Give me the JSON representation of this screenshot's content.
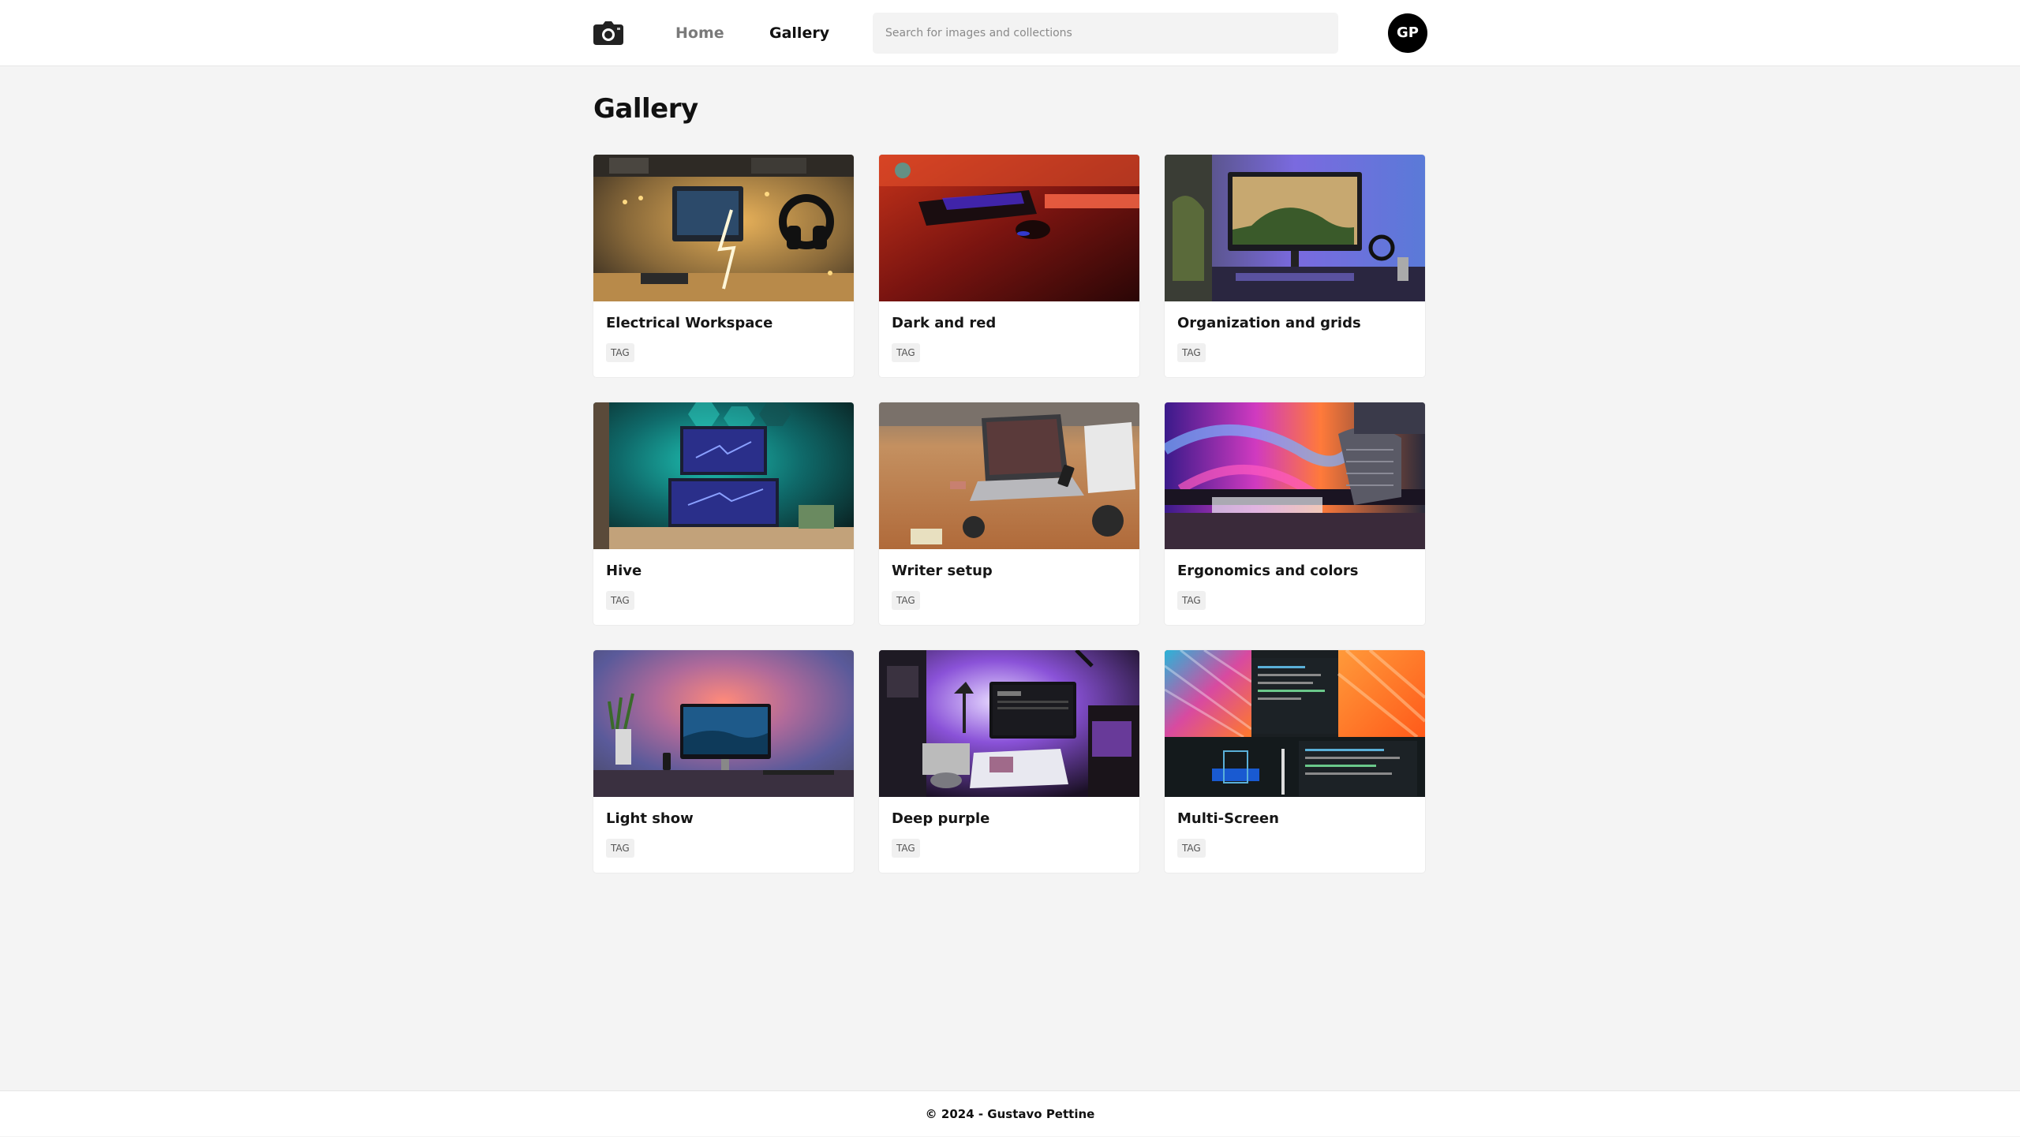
{
  "header": {
    "nav": {
      "home": "Home",
      "gallery": "Gallery"
    },
    "search": {
      "placeholder": "Search for images and collections",
      "value": ""
    },
    "avatar": "GP"
  },
  "page": {
    "title": "Gallery"
  },
  "cards": [
    {
      "title": "Electrical Workspace",
      "tag": "TAG",
      "theme": "electrical"
    },
    {
      "title": "Dark and red",
      "tag": "TAG",
      "theme": "darkred"
    },
    {
      "title": "Organization and grids",
      "tag": "TAG",
      "theme": "organization"
    },
    {
      "title": "Hive",
      "tag": "TAG",
      "theme": "hive"
    },
    {
      "title": "Writer setup",
      "tag": "TAG",
      "theme": "writer"
    },
    {
      "title": "Ergonomics and colors",
      "tag": "TAG",
      "theme": "ergonomics"
    },
    {
      "title": "Light show",
      "tag": "TAG",
      "theme": "lightshow"
    },
    {
      "title": "Deep purple",
      "tag": "TAG",
      "theme": "deeppurple"
    },
    {
      "title": "Multi-Screen",
      "tag": "TAG",
      "theme": "multiscreen"
    }
  ],
  "footer": {
    "text": "© 2024 - Gustavo Pettine"
  },
  "colors": {
    "background": "#f4f4f4",
    "surface": "#ffffff",
    "text": "#111111",
    "muted": "#7a7a7a",
    "avatar": "#000000"
  },
  "icons": {
    "logo": "camera-icon"
  }
}
